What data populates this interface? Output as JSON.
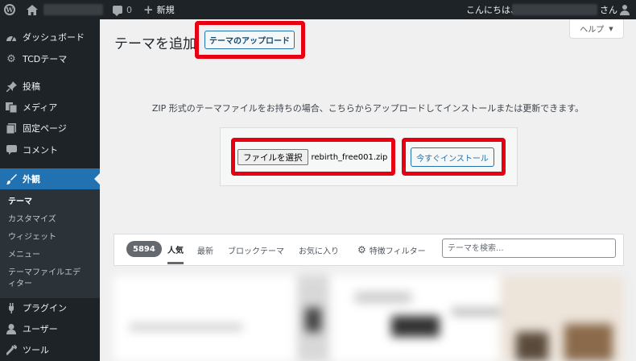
{
  "adminbar": {
    "comment_count": "0",
    "new_label": "新規",
    "greeting": "こんにちは、",
    "greeting_suffix": "さん"
  },
  "sidebar": {
    "items": [
      {
        "label": "ダッシュボード",
        "icon": "dashboard-icon"
      },
      {
        "label": "TCDテーマ",
        "icon": "gear-icon"
      },
      {
        "label": "投稿",
        "icon": "pin-icon"
      },
      {
        "label": "メディア",
        "icon": "media-icon"
      },
      {
        "label": "固定ページ",
        "icon": "page-icon"
      },
      {
        "label": "コメント",
        "icon": "comment-icon"
      },
      {
        "label": "外観",
        "icon": "brush-icon"
      },
      {
        "label": "プラグイン",
        "icon": "plugin-icon"
      },
      {
        "label": "ユーザー",
        "icon": "user-icon"
      },
      {
        "label": "ツール",
        "icon": "wrench-icon"
      }
    ],
    "submenu": [
      "テーマ",
      "カスタマイズ",
      "ウィジェット",
      "メニュー",
      "テーマファイルエディター"
    ]
  },
  "main": {
    "title": "テーマを追加",
    "upload_button": "テーマのアップロード",
    "help_label": "ヘルプ",
    "upload_info": "ZIP 形式のテーマファイルをお持ちの場合、こちらからアップロードしてインストールまたは更新できます。",
    "file_button": "ファイルを選択",
    "file_name": "rebirth_free001.zip",
    "install_button": "今すぐインストール"
  },
  "filter": {
    "count": "5894",
    "tabs": [
      "人気",
      "最新",
      "ブロックテーマ",
      "お気に入り"
    ],
    "feature_filter": "特徴フィルター",
    "search_placeholder": "テーマを検索..."
  },
  "colors": {
    "highlight": "#e60012",
    "accent": "#2271b1",
    "sidebar_bg": "#1d2327"
  }
}
